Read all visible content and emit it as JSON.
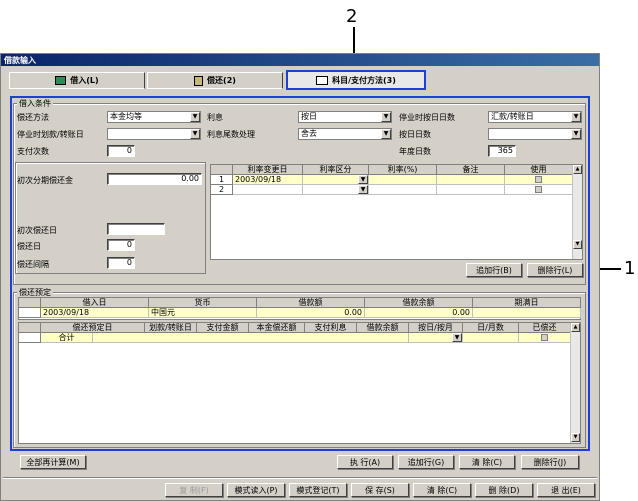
{
  "window": {
    "title": "借款输入"
  },
  "tabs": [
    {
      "label": "借入(L)",
      "icon": "book-icon"
    },
    {
      "label": "偿还(2)",
      "icon": "ledger-icon"
    },
    {
      "label": "科目/支付方法(3)",
      "icon": "payment-icon"
    }
  ],
  "callouts": {
    "top": "2",
    "right": "1"
  },
  "conditions": {
    "legend": "借入条件",
    "repay_method": {
      "label": "偿还方法",
      "value": "本金均等"
    },
    "interest": {
      "label": "利息",
      "value": "按日"
    },
    "daily_basis": {
      "label": "停业时按日日数",
      "value": "汇款/转账日"
    },
    "transfer_day": {
      "label": "停业时划款/转账日",
      "value": ""
    },
    "rounding": {
      "label": "利息尾数处理",
      "value": "舍去"
    },
    "day_count": {
      "label": "按日日数",
      "value": ""
    },
    "payments": {
      "label": "支付次数",
      "value": "0"
    },
    "year_days": {
      "label": "年度日数",
      "value": "365"
    },
    "first_installment": {
      "label": "初次分期偿还金",
      "value": "0.00"
    },
    "first_repay_date": {
      "label": "初次偿还日",
      "value": ""
    },
    "repay_day": {
      "label": "偿还日",
      "value": "0"
    },
    "repay_interval": {
      "label": "偿还间隔",
      "value": "0"
    },
    "rate_table": {
      "headers": [
        "利率变更日",
        "利率区分",
        "利率(%)",
        "备注",
        "使用"
      ],
      "rows": [
        {
          "no": "1",
          "date": "2003/09/18"
        },
        {
          "no": "2",
          "date": ""
        }
      ]
    },
    "add_row": "追加行(B)",
    "delete_row": "删除行(L)"
  },
  "schedule": {
    "legend": "偿还预定",
    "top_headers": [
      "借入日",
      "货币",
      "借款额",
      "借款余额",
      "期满日"
    ],
    "top_row": {
      "date": "2003/09/18",
      "currency": "中国元",
      "amount": "0.00",
      "balance": "0.00",
      "maturity": ""
    },
    "headers": [
      "偿还预定日",
      "划款/转账日",
      "支付金额",
      "本金偿还额",
      "支付利息",
      "借款余额",
      "按日/按月",
      "日/月数",
      "已偿还"
    ],
    "total_label": "合计"
  },
  "buttons": {
    "recalc": "全部再计算(M)",
    "execute": "执 行(A)",
    "add_row": "追加行(G)",
    "clear": "清 除(C)",
    "delete_row": "删除行(J)"
  },
  "bottom_buttons": [
    {
      "label": "复 制(F)",
      "disabled": true
    },
    {
      "label": "模式读入(P)",
      "disabled": false
    },
    {
      "label": "模式登记(T)",
      "disabled": false
    },
    {
      "label": "保 存(S)",
      "disabled": false
    },
    {
      "label": "清 除(C)",
      "disabled": false
    },
    {
      "label": "删 除(D)",
      "disabled": false
    },
    {
      "label": "退 出(E)",
      "disabled": false
    }
  ]
}
